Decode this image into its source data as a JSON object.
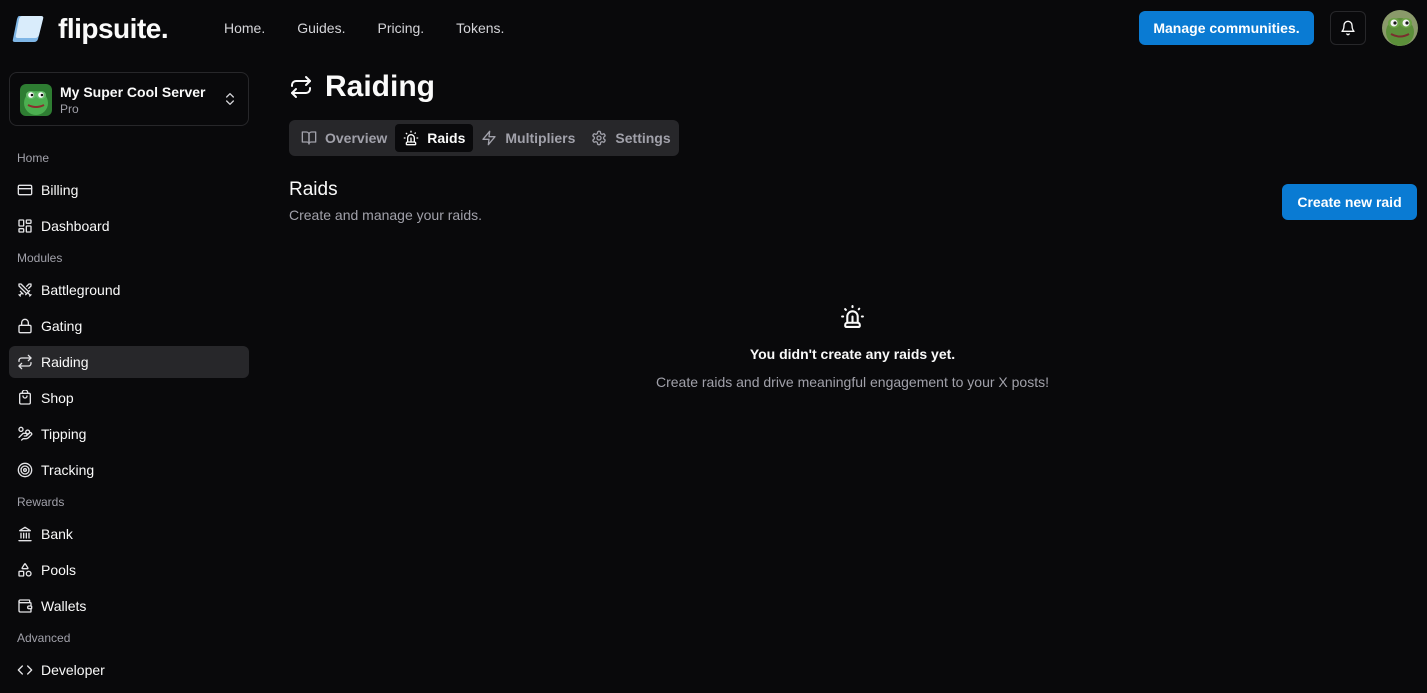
{
  "brand": {
    "name": "flipsuite.",
    "accent": "#0a7bd3"
  },
  "nav": {
    "items": [
      "Home.",
      "Guides.",
      "Pricing.",
      "Tokens."
    ]
  },
  "header": {
    "manage_label": "Manage communities."
  },
  "server": {
    "name": "My Super Cool Server",
    "plan": "Pro"
  },
  "sidebar": {
    "sections": {
      "home": "Home",
      "modules": "Modules",
      "rewards": "Rewards",
      "advanced": "Advanced"
    },
    "items": [
      {
        "label": "Billing",
        "icon": "credit-card-icon"
      },
      {
        "label": "Dashboard",
        "icon": "layout-grid-icon"
      },
      {
        "label": "Battleground",
        "icon": "swords-icon"
      },
      {
        "label": "Gating",
        "icon": "lock-icon"
      },
      {
        "label": "Raiding",
        "icon": "repeat-icon",
        "active": true
      },
      {
        "label": "Shop",
        "icon": "shopping-bag-icon"
      },
      {
        "label": "Tipping",
        "icon": "hand-coins-icon"
      },
      {
        "label": "Tracking",
        "icon": "target-icon"
      },
      {
        "label": "Bank",
        "icon": "landmark-icon"
      },
      {
        "label": "Pools",
        "icon": "shapes-icon"
      },
      {
        "label": "Wallets",
        "icon": "wallet-icon"
      },
      {
        "label": "Developer",
        "icon": "code-icon"
      }
    ]
  },
  "page": {
    "title": "Raiding",
    "tabs": [
      {
        "label": "Overview",
        "icon": "book-open-icon"
      },
      {
        "label": "Raids",
        "icon": "siren-icon",
        "active": true
      },
      {
        "label": "Multipliers",
        "icon": "zap-icon"
      },
      {
        "label": "Settings",
        "icon": "gear-icon"
      }
    ],
    "section_title": "Raids",
    "section_subtitle": "Create and manage your raids.",
    "create_label": "Create new raid",
    "empty_title": "You didn't create any raids yet.",
    "empty_subtitle": "Create raids and drive meaningful engagement to your X posts!"
  }
}
